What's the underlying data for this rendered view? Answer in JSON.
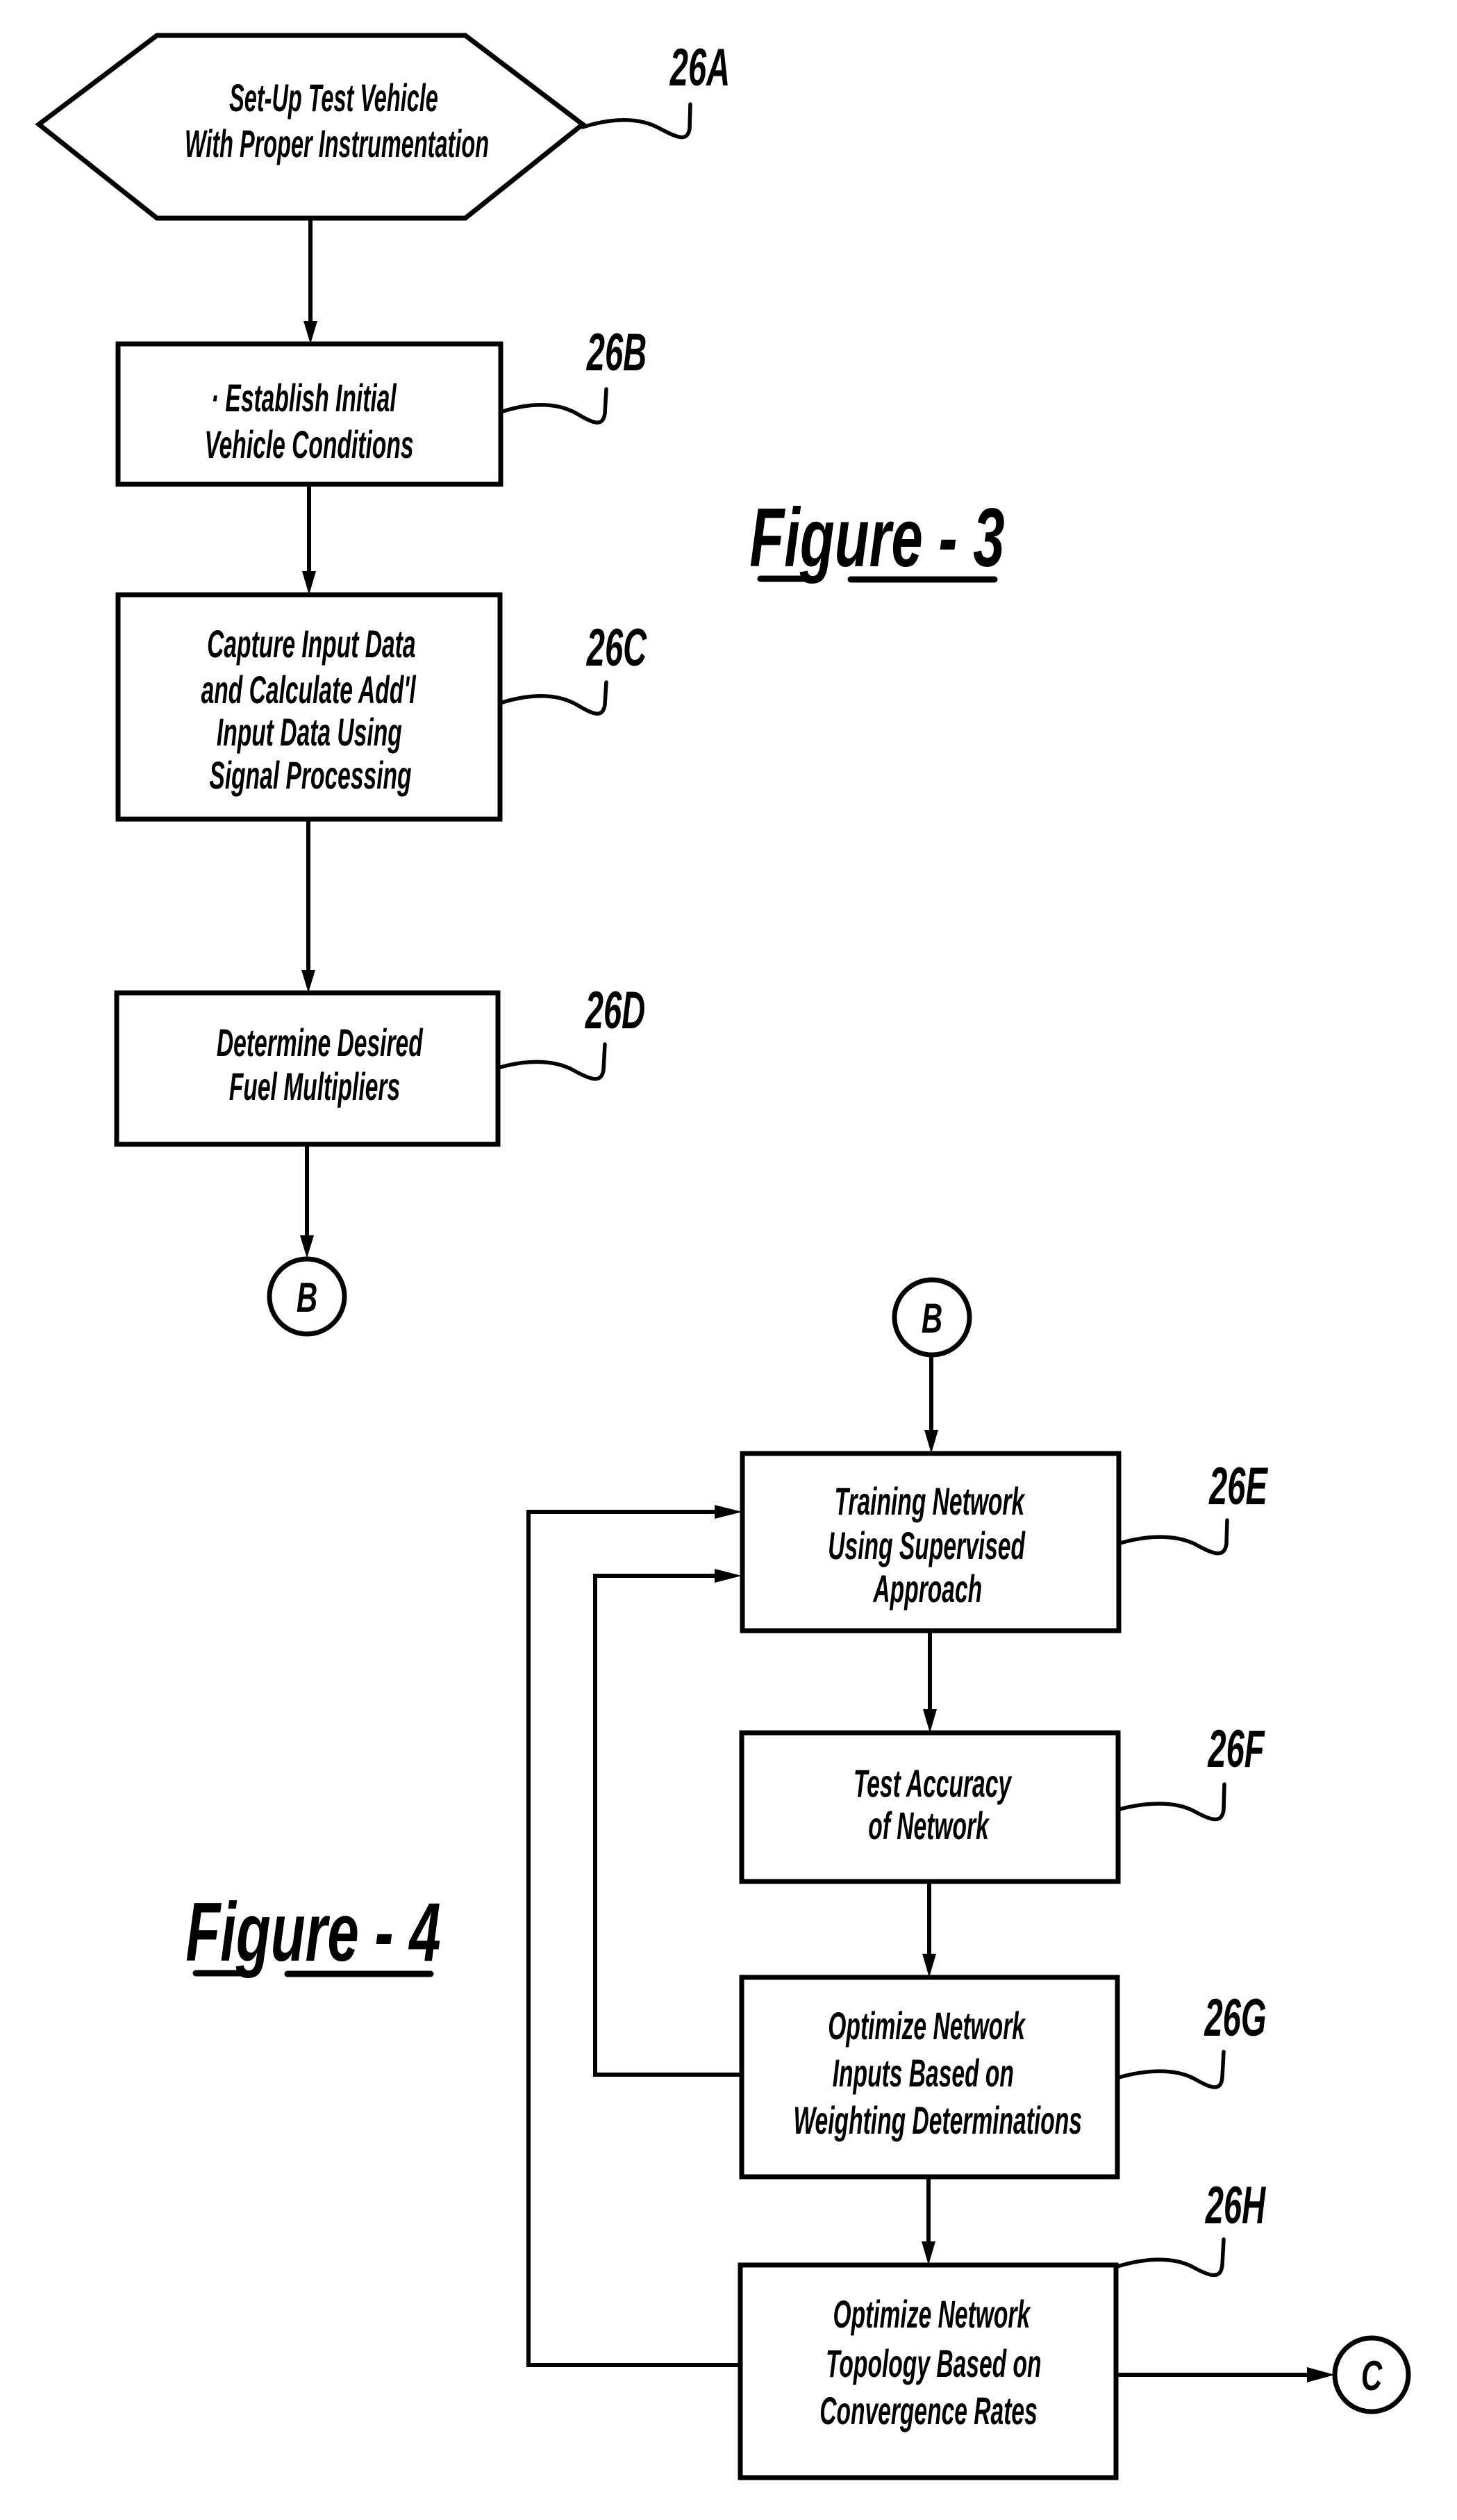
{
  "figure3": {
    "title": "Figure - 3",
    "steps": [
      {
        "ref": "26A",
        "shape": "hexagon",
        "lines": [
          "Set-Up Test Vehicle",
          "With Proper Instrumentation"
        ]
      },
      {
        "ref": "26B",
        "shape": "box",
        "lines": [
          "· Establish Initial",
          "Vehicle Conditions"
        ]
      },
      {
        "ref": "26C",
        "shape": "box",
        "lines": [
          "Capture Input Data",
          "and Calculate Add'l",
          "Input Data Using",
          "Signal Processing"
        ]
      },
      {
        "ref": "26D",
        "shape": "box",
        "lines": [
          "Determine Desired",
          "Fuel Multipliers"
        ]
      }
    ],
    "connector_out": "B"
  },
  "figure4": {
    "title": "Figure - 4",
    "connector_in": "B",
    "steps": [
      {
        "ref": "26E",
        "shape": "box",
        "lines": [
          "Training Network",
          "Using Supervised",
          "Approach"
        ]
      },
      {
        "ref": "26F",
        "shape": "box",
        "lines": [
          "Test Accuracy",
          "of Network"
        ]
      },
      {
        "ref": "26G",
        "shape": "box",
        "lines": [
          "Optimize Network",
          "Inputs Based on",
          "Weighting Determinations"
        ]
      },
      {
        "ref": "26H",
        "shape": "box",
        "lines": [
          "Optimize Network",
          "Topology Based on",
          "Convergence Rates"
        ]
      }
    ],
    "loops": [
      {
        "from": "26G",
        "to": "26E"
      },
      {
        "from": "26H",
        "to": "26E"
      }
    ],
    "connector_out": "C"
  }
}
